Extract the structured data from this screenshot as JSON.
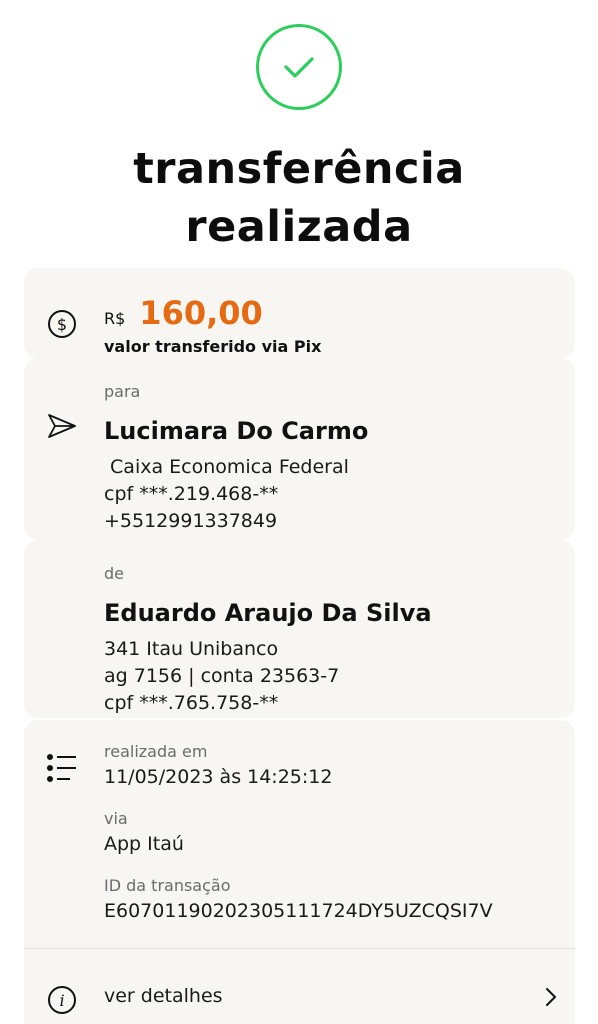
{
  "header": {
    "title_line1": "transferência",
    "title_line2": "realizada",
    "status_color": "#2ccf5b"
  },
  "amount_card": {
    "currency": "R$",
    "value": "160,00",
    "caption": "valor transferido via Pix",
    "accent_color": "#e56a12"
  },
  "recipient": {
    "label": "para",
    "name": "Lucimara Do Carmo",
    "bank": " Caixa Economica Federal",
    "cpf": "cpf ***.219.468-**",
    "phone": "+5512991337849"
  },
  "sender": {
    "label": "de",
    "name": "Eduardo Araujo Da Silva",
    "bank": "341 Itau Unibanco",
    "account": "ag 7156 | conta 23563-7",
    "cpf": "cpf ***.765.758-**"
  },
  "details": {
    "date_label": "realizada em",
    "date_value": "11/05/2023 às 14:25:12",
    "via_label": "via",
    "via_value": "App Itaú",
    "id_label": "ID da transação",
    "id_value": "E60701190202305111724DY5UZCQSI7V",
    "more_label": "ver detalhes"
  }
}
